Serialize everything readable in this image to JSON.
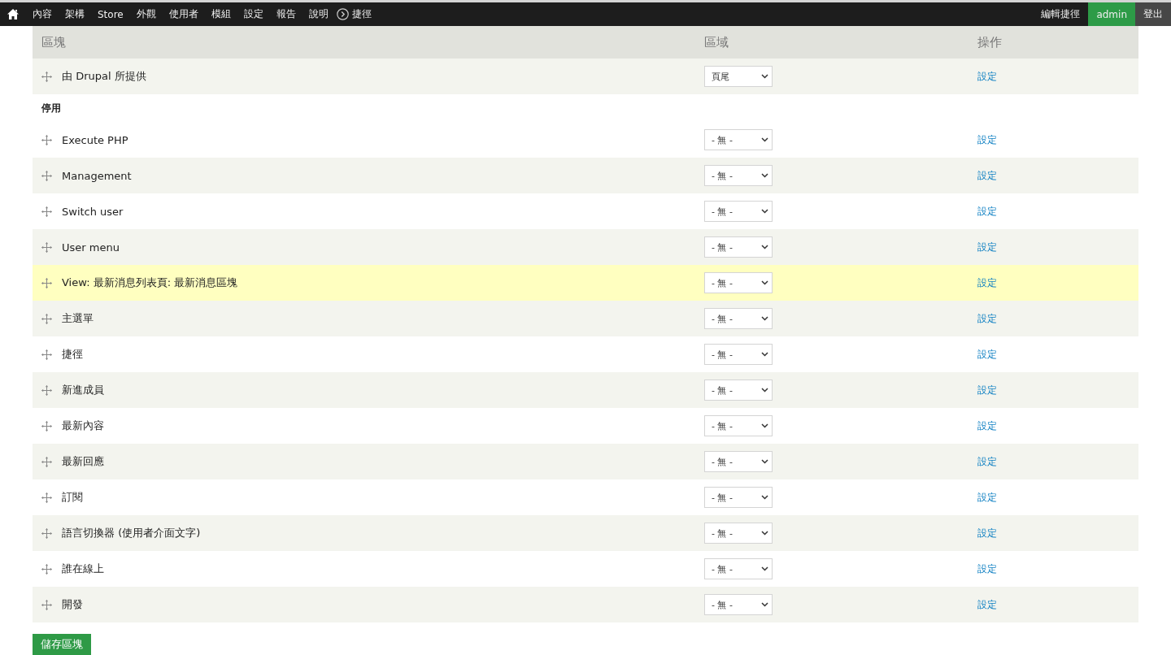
{
  "toolbar": {
    "menu": [
      {
        "label": "內容"
      },
      {
        "label": "架構"
      },
      {
        "label": "Store"
      },
      {
        "label": "外觀"
      },
      {
        "label": "使用者"
      },
      {
        "label": "模組"
      },
      {
        "label": "設定"
      },
      {
        "label": "報告"
      },
      {
        "label": "說明"
      }
    ],
    "shortcuts": "捷徑",
    "right": [
      {
        "label": "編輯捷徑",
        "kind": "link"
      },
      {
        "label": "admin",
        "kind": "user"
      },
      {
        "label": "登出",
        "kind": "logout"
      }
    ]
  },
  "table": {
    "columns": [
      "區塊",
      "區域",
      "操作"
    ],
    "sections": [
      {
        "rows": [
          {
            "name": "由 Drupal 所提供",
            "region": "頁尾",
            "operation": "設定",
            "highlighted": false
          }
        ]
      },
      {
        "title": "停用",
        "rows": [
          {
            "name": "Execute PHP",
            "region": "- 無 -",
            "operation": "設定",
            "highlighted": false
          },
          {
            "name": "Management",
            "region": "- 無 -",
            "operation": "設定",
            "highlighted": false
          },
          {
            "name": "Switch user",
            "region": "- 無 -",
            "operation": "設定",
            "highlighted": false
          },
          {
            "name": "User menu",
            "region": "- 無 -",
            "operation": "設定",
            "highlighted": false
          },
          {
            "name": "View: 最新消息列表頁: 最新消息區塊",
            "region": "- 無 -",
            "operation": "設定",
            "highlighted": true
          },
          {
            "name": "主選單",
            "region": "- 無 -",
            "operation": "設定",
            "highlighted": false
          },
          {
            "name": "捷徑",
            "region": "- 無 -",
            "operation": "設定",
            "highlighted": false
          },
          {
            "name": "新進成員",
            "region": "- 無 -",
            "operation": "設定",
            "highlighted": false
          },
          {
            "name": "最新內容",
            "region": "- 無 -",
            "operation": "設定",
            "highlighted": false
          },
          {
            "name": "最新回應",
            "region": "- 無 -",
            "operation": "設定",
            "highlighted": false
          },
          {
            "name": "訂閱",
            "region": "- 無 -",
            "operation": "設定",
            "highlighted": false
          },
          {
            "name": "語言切換器 (使用者介面文字)",
            "region": "- 無 -",
            "operation": "設定",
            "highlighted": false
          },
          {
            "name": "誰在線上",
            "region": "- 無 -",
            "operation": "設定",
            "highlighted": false
          },
          {
            "name": "開發",
            "region": "- 無 -",
            "operation": "設定",
            "highlighted": false
          }
        ]
      }
    ]
  },
  "save_button": "儲存區塊"
}
